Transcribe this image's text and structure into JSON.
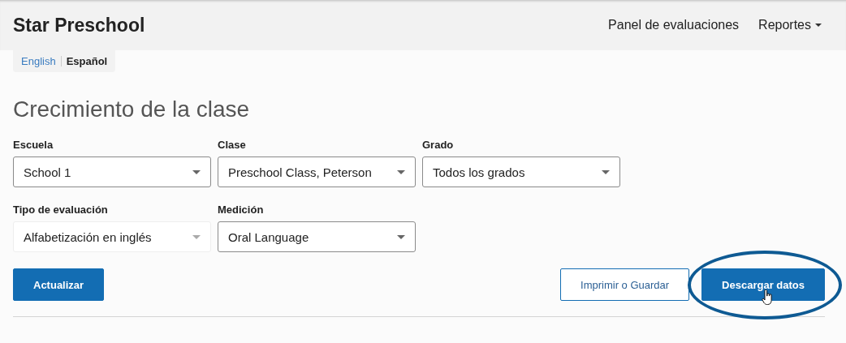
{
  "header": {
    "brand": "Star Preschool",
    "nav": [
      {
        "label": "Panel de evaluaciones",
        "kind": "link"
      },
      {
        "label": "Reportes",
        "kind": "dropdown"
      }
    ]
  },
  "languages": [
    {
      "label": "English",
      "selected": false
    },
    {
      "label": "Español",
      "selected": true
    }
  ],
  "title": "Crecimiento de la clase",
  "filters": [
    [
      {
        "label": "Escuela",
        "value": "School 1",
        "disabled": false
      },
      {
        "label": "Clase",
        "value": "Preschool Class, Peterson",
        "disabled": false
      },
      {
        "label": "Grado",
        "value": "Todos los grados",
        "disabled": false
      }
    ],
    [
      {
        "label": "Tipo de evaluación",
        "value": "Alfabetización en inglés",
        "disabled": true
      },
      {
        "label": "Medición",
        "value": "Oral Language",
        "disabled": false
      }
    ]
  ],
  "buttons": [
    {
      "label": "Actualizar",
      "kind": "primary",
      "highlighted": false
    },
    {
      "label": "Imprimir o Guardar",
      "kind": "outline",
      "highlighted": false
    },
    {
      "label": "Descargar datos",
      "kind": "primary",
      "highlighted": true
    }
  ]
}
